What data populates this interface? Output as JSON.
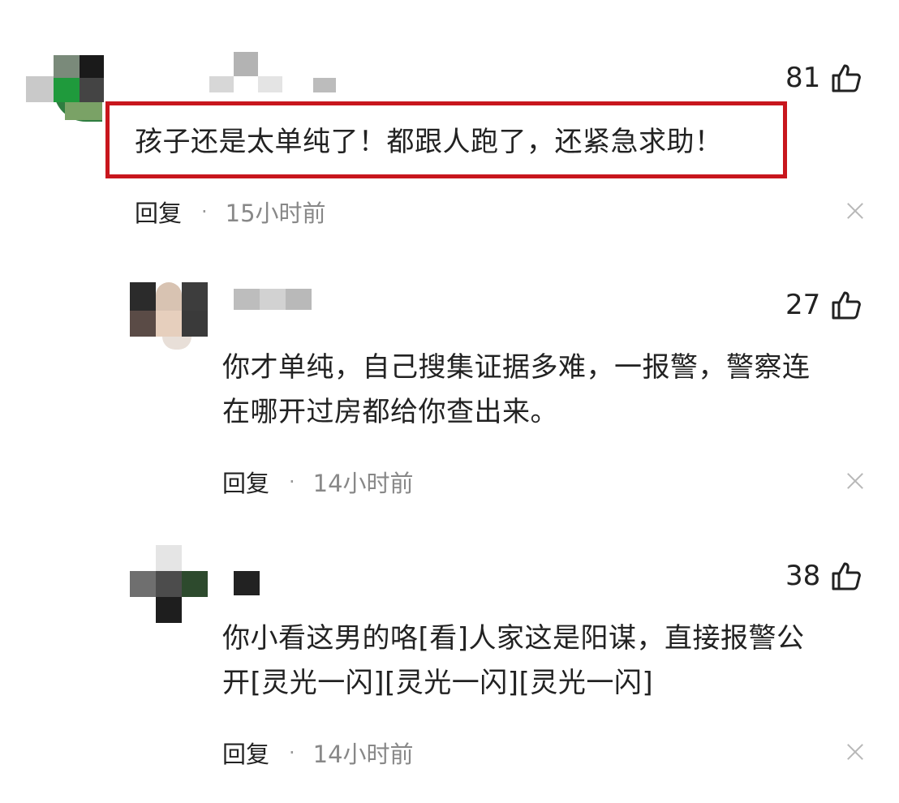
{
  "comments": [
    {
      "text": "孩子还是太单纯了！都跟人跑了，还紧急求助！",
      "likes": "81",
      "reply_label": "回复",
      "separator": "·",
      "time": "15小时前",
      "highlighted": true
    },
    {
      "text_lines": [
        "你才单纯，自己搜集证据多难，一报警，警察连",
        "在哪开过房都给你查出来。"
      ],
      "likes": "27",
      "reply_label": "回复",
      "separator": "·",
      "time": "14小时前"
    },
    {
      "text_lines": [
        "你小看这男的咯[看]人家这是阳谋，直接报警公",
        "开[灵光一闪][灵光一闪][灵光一闪]"
      ],
      "likes": "38",
      "reply_label": "回复",
      "separator": "·",
      "time": "14小时前"
    }
  ],
  "icons": {
    "like": "thumbs-up-icon",
    "dismiss": "close-icon"
  },
  "colors": {
    "highlight_border": "#c8161d",
    "time_text": "#888888"
  }
}
